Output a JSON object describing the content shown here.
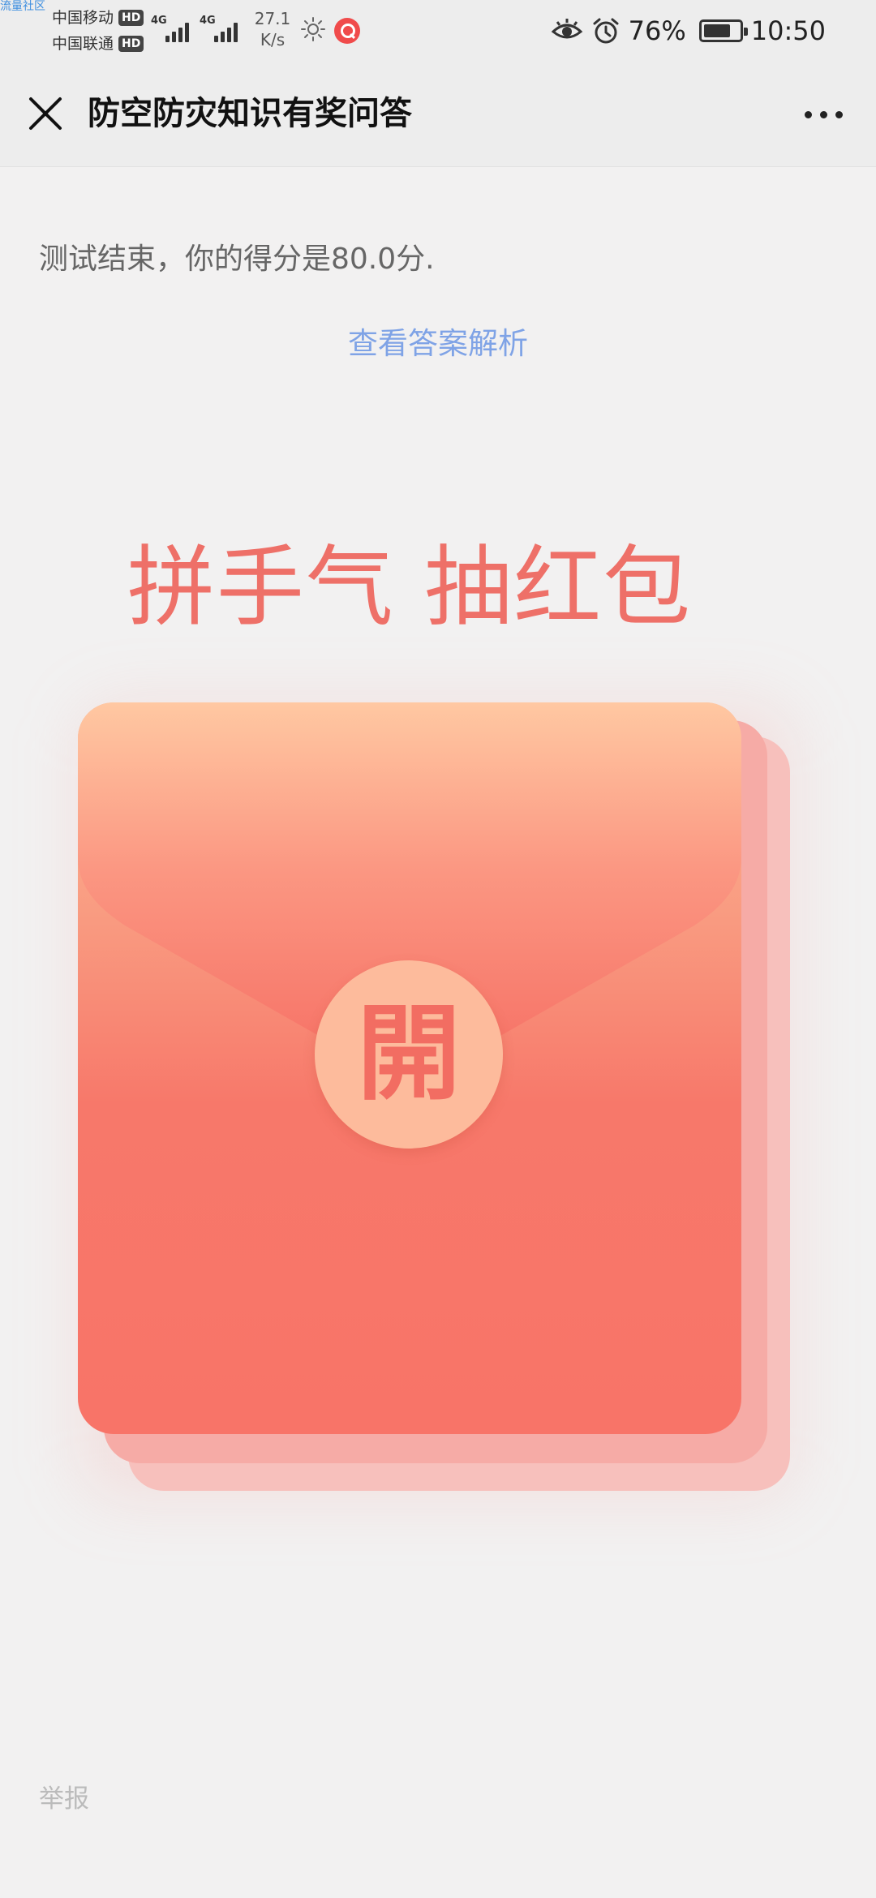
{
  "status_bar": {
    "watermark": "流量社区",
    "carrier_1": "中国移动",
    "carrier_2": "中国联通",
    "hd_badge": "HD",
    "network_type": "4G",
    "speed_value": "27.1",
    "speed_unit": "K/s",
    "battery_percent": "76%",
    "battery_level": 0.76,
    "time": "10:50"
  },
  "title_bar": {
    "title": "防空防灾知识有奖问答"
  },
  "main": {
    "result_text": "测试结束，你的得分是80.0分.",
    "answer_link": "查看答案解析",
    "promo_title": "拼手气 抽红包",
    "open_button_label": "開"
  },
  "footer": {
    "report_label": "举报"
  },
  "colors": {
    "accent_red": "#f87468",
    "link_blue": "#7fa3e6",
    "background": "#f2f1f1"
  }
}
